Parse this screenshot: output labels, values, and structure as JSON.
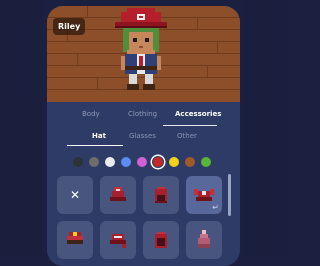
{
  "character": {
    "name": "Riley"
  },
  "tabs": [
    {
      "label": "Body",
      "active": false
    },
    {
      "label": "Clothing",
      "active": false
    },
    {
      "label": "Accessories",
      "active": true
    }
  ],
  "subtabs": [
    {
      "label": "Hat",
      "active": true
    },
    {
      "label": "Glasses",
      "active": false
    },
    {
      "label": "Other",
      "active": false
    }
  ],
  "colors": {
    "swatches": [
      "#2a3434",
      "#6d6d6d",
      "#ececec",
      "#5b8ef0",
      "#d062d6",
      "#c42828",
      "#f3d21a",
      "#a05a2a",
      "#5ab43c"
    ],
    "selected_index": 5,
    "accent": "#2e3b66",
    "wood": "#8c4f2a"
  },
  "items": [
    {
      "icon": "none-x-icon"
    },
    {
      "icon": "cap-icon"
    },
    {
      "icon": "helmet-icon"
    },
    {
      "icon": "pirate-hat-icon"
    },
    {
      "icon": "captain-hat-icon"
    },
    {
      "icon": "bandana-cap-icon"
    },
    {
      "icon": "hood-icon"
    },
    {
      "icon": "beanie-icon"
    }
  ],
  "selected_item_index": 3,
  "equipped_label": "↵"
}
